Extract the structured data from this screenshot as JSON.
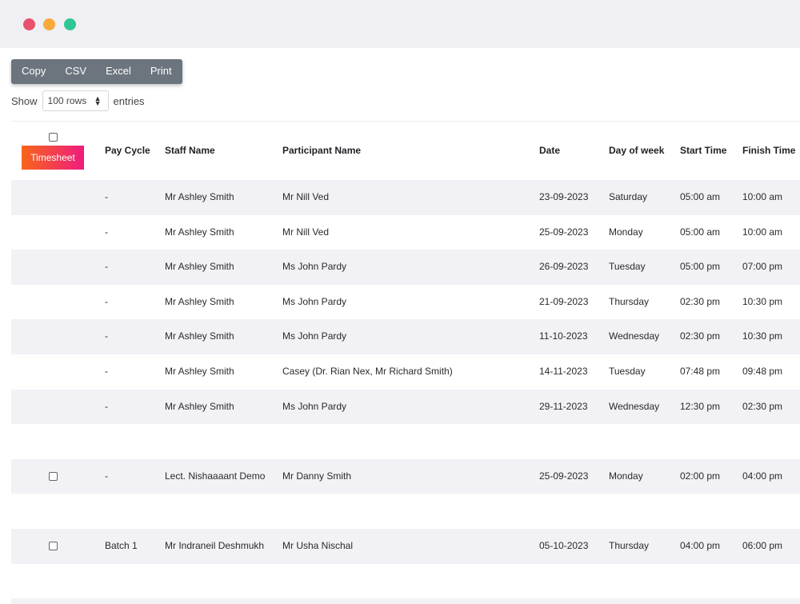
{
  "window": {
    "controls": [
      "close-dot",
      "minimize-dot",
      "maximize-dot"
    ]
  },
  "toolbar": {
    "buttons": [
      "Copy",
      "CSV",
      "Excel",
      "Print"
    ]
  },
  "length": {
    "show_label": "Show",
    "selected": "100 rows",
    "entries_label": "entries"
  },
  "table": {
    "timesheet_label": "Timesheet",
    "columns": [
      "Pay Cycle",
      "Staff Name",
      "Participant Name",
      "Date",
      "Day of week",
      "Start Time",
      "Finish Time"
    ],
    "rows": [
      {
        "checkbox": false,
        "pay_cycle": "-",
        "staff": "Mr Ashley Smith",
        "participant": "Mr Nill Ved",
        "date": "23-09-2023",
        "day": "Saturday",
        "start": "05:00 am",
        "finish": "10:00 am"
      },
      {
        "checkbox": false,
        "pay_cycle": "-",
        "staff": "Mr Ashley Smith",
        "participant": "Mr Nill Ved",
        "date": "25-09-2023",
        "day": "Monday",
        "start": "05:00 am",
        "finish": "10:00 am"
      },
      {
        "checkbox": false,
        "pay_cycle": "-",
        "staff": "Mr Ashley Smith",
        "participant": "Ms John Pardy",
        "date": "26-09-2023",
        "day": "Tuesday",
        "start": "05:00 pm",
        "finish": "07:00 pm"
      },
      {
        "checkbox": false,
        "pay_cycle": "-",
        "staff": "Mr Ashley Smith",
        "participant": "Ms John Pardy",
        "date": "21-09-2023",
        "day": "Thursday",
        "start": "02:30 pm",
        "finish": "10:30 pm"
      },
      {
        "checkbox": false,
        "pay_cycle": "-",
        "staff": "Mr Ashley Smith",
        "participant": "Ms John Pardy",
        "date": "11-10-2023",
        "day": "Wednesday",
        "start": "02:30 pm",
        "finish": "10:30 pm"
      },
      {
        "checkbox": false,
        "pay_cycle": "-",
        "staff": "Mr Ashley Smith",
        "participant": "Casey (Dr. Rian Nex, Mr Richard Smith)",
        "date": "14-11-2023",
        "day": "Tuesday",
        "start": "07:48 pm",
        "finish": "09:48 pm"
      },
      {
        "checkbox": false,
        "pay_cycle": "-",
        "staff": "Mr Ashley Smith",
        "participant": "Ms John Pardy",
        "date": "29-11-2023",
        "day": "Wednesday",
        "start": "12:30 pm",
        "finish": "02:30 pm"
      },
      {
        "empty": true
      },
      {
        "checkbox": true,
        "pay_cycle": "-",
        "staff": "Lect. Nishaaaant Demo",
        "participant": "Mr Danny Smith",
        "date": "25-09-2023",
        "day": "Monday",
        "start": "02:00 pm",
        "finish": "04:00 pm"
      },
      {
        "empty": true
      },
      {
        "checkbox": true,
        "pay_cycle": "Batch 1",
        "staff": "Mr Indraneil Deshmukh",
        "participant": "Mr Usha Nischal",
        "date": "05-10-2023",
        "day": "Thursday",
        "start": "04:00 pm",
        "finish": "06:00 pm"
      },
      {
        "empty": true
      },
      {
        "empty": true
      }
    ]
  }
}
